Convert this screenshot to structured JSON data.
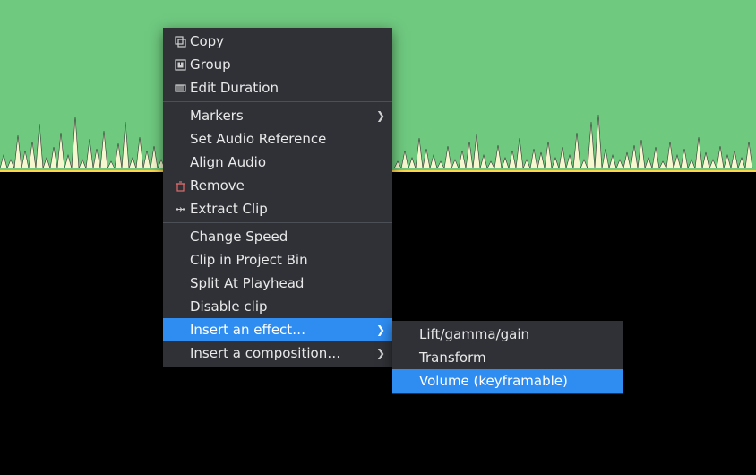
{
  "menu": {
    "items": [
      {
        "label": "Copy",
        "icon": "copy",
        "arrow": false,
        "sep": false
      },
      {
        "label": "Group",
        "icon": "group",
        "arrow": false,
        "sep": false
      },
      {
        "label": "Edit Duration",
        "icon": "duration",
        "arrow": false,
        "sep": true
      },
      {
        "label": "Markers",
        "icon": "",
        "arrow": true,
        "sep": false
      },
      {
        "label": "Set Audio Reference",
        "icon": "",
        "arrow": false,
        "sep": false
      },
      {
        "label": "Align Audio",
        "icon": "",
        "arrow": false,
        "sep": false
      },
      {
        "label": "Remove",
        "icon": "trash",
        "arrow": false,
        "sep": false
      },
      {
        "label": "Extract Clip",
        "icon": "extract",
        "arrow": false,
        "sep": true
      },
      {
        "label": "Change Speed",
        "icon": "",
        "arrow": false,
        "sep": false
      },
      {
        "label": "Clip in Project Bin",
        "icon": "",
        "arrow": false,
        "sep": false
      },
      {
        "label": "Split At Playhead",
        "icon": "",
        "arrow": false,
        "sep": false
      },
      {
        "label": "Disable clip",
        "icon": "",
        "arrow": false,
        "sep": false
      },
      {
        "label": "Insert an effect…",
        "icon": "",
        "arrow": true,
        "sep": false,
        "highlight": true
      },
      {
        "label": "Insert a composition…",
        "icon": "",
        "arrow": true,
        "sep": false
      }
    ]
  },
  "submenu": {
    "items": [
      {
        "label": "Lift/gamma/gain"
      },
      {
        "label": "Transform"
      },
      {
        "label": "Volume (keyframable)",
        "highlight": true
      }
    ]
  },
  "colors": {
    "track": "#6fc97f",
    "menu_bg": "#2f3136",
    "highlight": "#2f8cf0"
  }
}
